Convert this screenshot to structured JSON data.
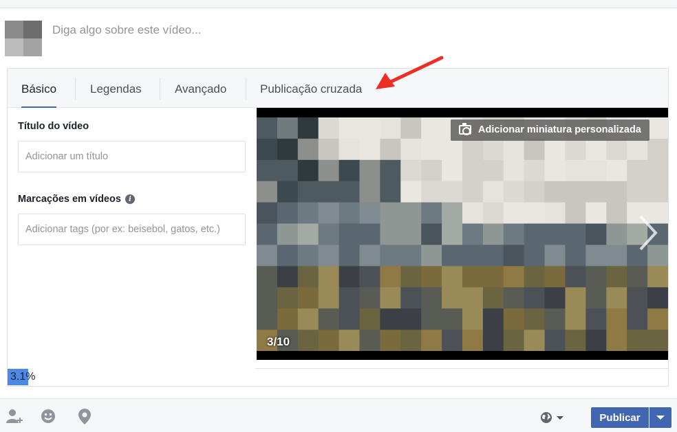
{
  "composer": {
    "status_placeholder": "Diga algo sobre este vídeo..."
  },
  "tabs": [
    {
      "label": "Básico",
      "active": true
    },
    {
      "label": "Legendas",
      "active": false
    },
    {
      "label": "Avançado",
      "active": false
    },
    {
      "label": "Publicação cruzada",
      "active": false
    }
  ],
  "form": {
    "title_label": "Título do vídeo",
    "title_placeholder": "Adicionar um título",
    "tags_label": "Marcações em vídeos",
    "tags_placeholder": "Adicionar tags (por ex: beisebol, gatos, etc.)"
  },
  "video": {
    "thumbnail_button": "Adicionar miniatura personalizada",
    "frame_counter": "3/10"
  },
  "upload": {
    "progress_text": "3.1%",
    "progress_percent": 3.1
  },
  "footer": {
    "publish_label": "Publicar",
    "icons": [
      "tag-friends-icon",
      "feeling-icon",
      "location-icon",
      "globe-icon"
    ]
  },
  "colors": {
    "primary": "#4267b2",
    "progress": "#4c89e6",
    "annotation_arrow": "#ec2f24"
  }
}
